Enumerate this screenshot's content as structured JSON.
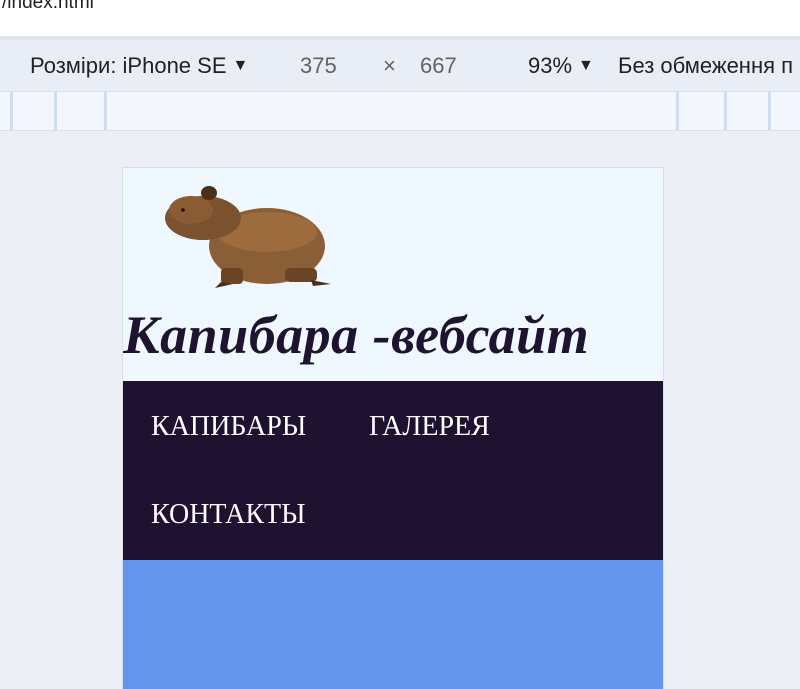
{
  "address_bar": {
    "url": "/index.html"
  },
  "device_toolbar": {
    "dimensions_label": "Розміри: iPhone SE",
    "width": "375",
    "times_symbol": "×",
    "height": "667",
    "zoom": "93%",
    "throttling": "Без обмеження п"
  },
  "site": {
    "header": {
      "title": "Капибара -вебсайт",
      "logo_icon": "capybara-logo"
    },
    "nav": {
      "items": [
        {
          "label": "КАПИБАРЫ"
        },
        {
          "label": "ГАЛЕРЕЯ"
        },
        {
          "label": "КОНТАКТЫ"
        }
      ]
    },
    "colors": {
      "header_bg": "#f0f8ff",
      "nav_bg": "#1f1130",
      "nav_text": "#ffffff",
      "title_text": "#1f1430",
      "content_bg": "#6495ed"
    }
  }
}
